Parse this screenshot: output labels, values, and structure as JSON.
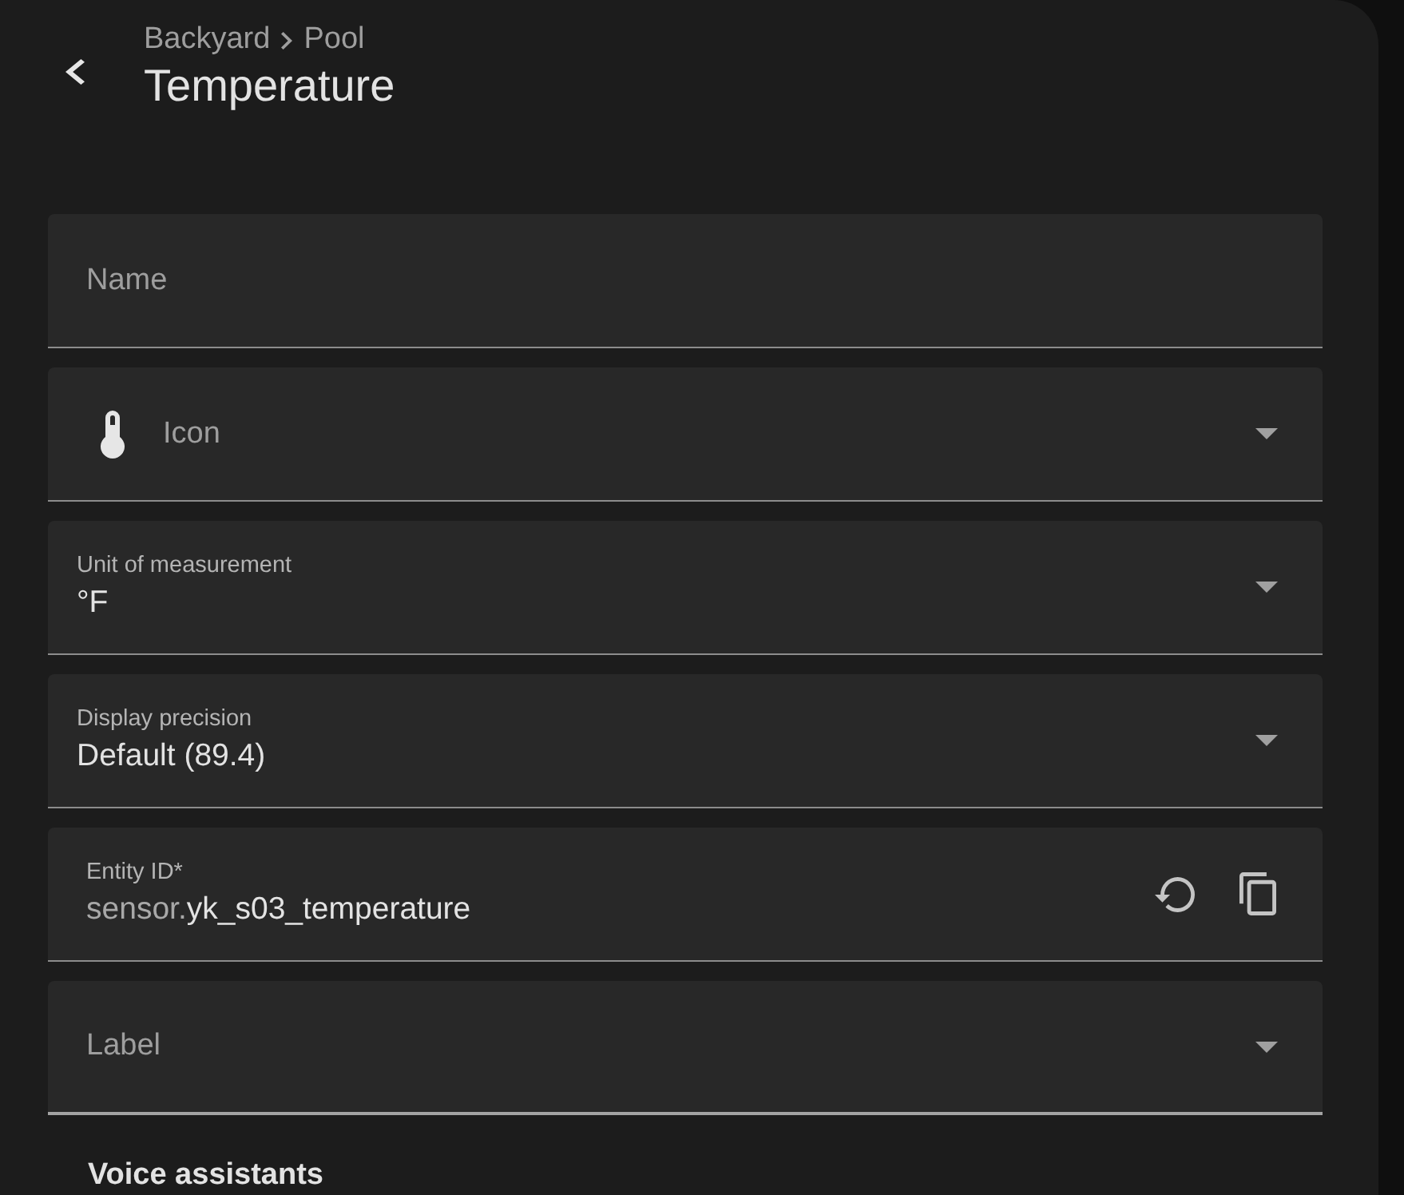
{
  "header": {
    "breadcrumb": [
      "Backyard",
      "Pool"
    ],
    "title": "Temperature"
  },
  "fields": [
    {
      "kind": "text",
      "label": "Name",
      "hovered": false
    },
    {
      "kind": "icon_select",
      "label": "Icon",
      "hovered": false
    },
    {
      "kind": "select",
      "label": "Unit of measurement",
      "value": "°F",
      "hovered": false
    },
    {
      "kind": "select",
      "label": "Display precision",
      "value": "Default (89.4)",
      "hovered": false
    },
    {
      "kind": "entity_id",
      "label": "Entity ID*",
      "prefix": "sensor.",
      "value": "yk_s03_temperature",
      "hovered": false
    },
    {
      "kind": "select",
      "label": "Label",
      "hovered": true
    }
  ],
  "section": {
    "title": "Voice assistants"
  }
}
